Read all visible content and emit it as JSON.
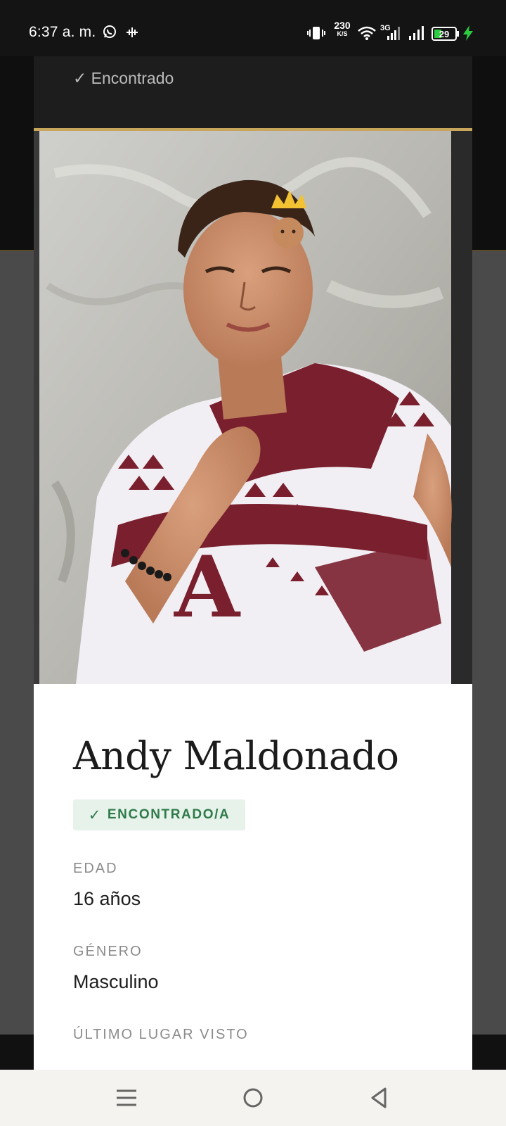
{
  "status_bar": {
    "time": "6:37 a. m.",
    "net_speed_value": "230",
    "net_speed_unit": "K/S",
    "network_type": "3G",
    "battery_level": "29",
    "icons": [
      "whatsapp-icon",
      "audio-wave-icon",
      "vibrate-icon",
      "wifi-icon",
      "signal-icon",
      "battery-icon",
      "charging-bolt-icon"
    ]
  },
  "header_card": {
    "status_text": "✓ Encontrado"
  },
  "profile": {
    "name": "Andy Maldonado",
    "badge": "ENCONTRADO/A",
    "badge_check": "✓",
    "fields": [
      {
        "label": "EDAD",
        "value": "16 años"
      },
      {
        "label": "GÉNERO",
        "value": "Masculino"
      },
      {
        "label": "ÚLTIMO LUGAR VISTO",
        "value": ""
      }
    ]
  },
  "colors": {
    "accent_gold": "#c7a55a",
    "badge_bg": "#e6f2ea",
    "badge_text": "#2f7a4a"
  },
  "nav_bar": {
    "icons": [
      "menu-icon",
      "home-icon",
      "back-icon"
    ]
  }
}
